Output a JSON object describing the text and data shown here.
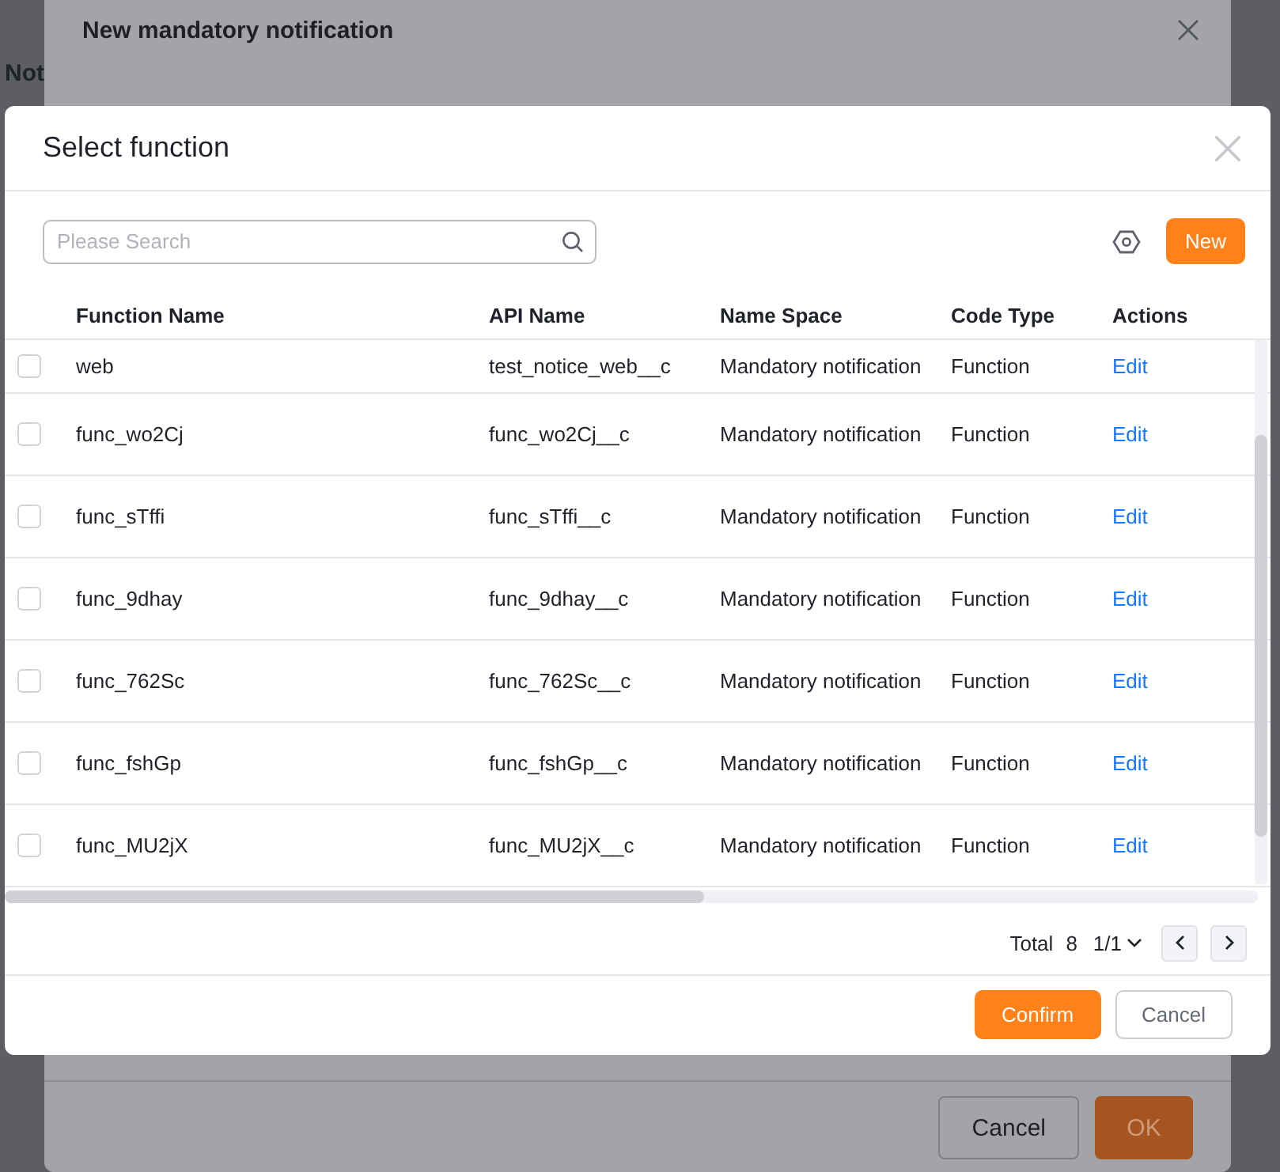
{
  "background_page": {
    "heading": "Not"
  },
  "back_dialog": {
    "title": "New mandatory notification",
    "buttons": [
      {
        "label": "Cancel",
        "kind": "secondary"
      },
      {
        "label": "OK",
        "kind": "primary"
      }
    ]
  },
  "dialog": {
    "title": "Select function",
    "search": {
      "placeholder": "Please Search"
    },
    "new_button": "New",
    "table": {
      "columns": [
        "Function Name",
        "API Name",
        "Name Space",
        "Code Type",
        "Actions"
      ],
      "rows": [
        {
          "checked": false,
          "function_name": "web",
          "api_name": "test_notice_web__c",
          "name_space": "Mandatory notification",
          "code_type": "Function",
          "action": "Edit"
        },
        {
          "checked": false,
          "function_name": "func_wo2Cj",
          "api_name": "func_wo2Cj__c",
          "name_space": "Mandatory notification",
          "code_type": "Function",
          "action": "Edit"
        },
        {
          "checked": false,
          "function_name": "func_sTffi",
          "api_name": "func_sTffi__c",
          "name_space": "Mandatory notification",
          "code_type": "Function",
          "action": "Edit"
        },
        {
          "checked": false,
          "function_name": "func_9dhay",
          "api_name": "func_9dhay__c",
          "name_space": "Mandatory notification",
          "code_type": "Function",
          "action": "Edit"
        },
        {
          "checked": false,
          "function_name": "func_762Sc",
          "api_name": "func_762Sc__c",
          "name_space": "Mandatory notification",
          "code_type": "Function",
          "action": "Edit"
        },
        {
          "checked": false,
          "function_name": "func_fshGp",
          "api_name": "func_fshGp__c",
          "name_space": "Mandatory notification",
          "code_type": "Function",
          "action": "Edit"
        },
        {
          "checked": false,
          "function_name": "func_MU2jX",
          "api_name": "func_MU2jX__c",
          "name_space": "Mandatory notification",
          "code_type": "Function",
          "action": "Edit"
        }
      ]
    },
    "pagination": {
      "total_label": "Total",
      "total": "8",
      "page": "1/1"
    },
    "buttons": [
      {
        "label": "Confirm",
        "kind": "primary"
      },
      {
        "label": "Cancel",
        "kind": "secondary"
      }
    ]
  }
}
